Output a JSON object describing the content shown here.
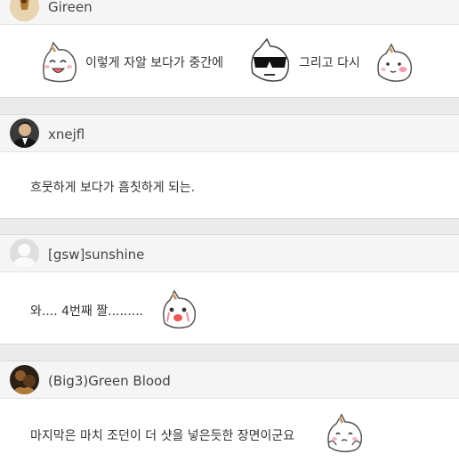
{
  "comments": [
    {
      "username": "Gireen",
      "segments": [
        "이렇게 자알 보다가 중간에",
        "그리고 다시"
      ],
      "emoticons": [
        "laughing-cat-icon",
        "sunglasses-cat-icon",
        "blushing-cat-icon"
      ]
    },
    {
      "username": "xnejfl",
      "text": "흐뭇하게 보다가 흠칫하게 되는."
    },
    {
      "username": "[gsw]sunshine",
      "text": "와.... 4번째 짤.........",
      "emoticons": [
        "crying-cat-icon"
      ]
    },
    {
      "username": "(Big3)Green Blood",
      "text": "마지막은 마치 조던이 더 샷을 넣은듯한 장면이군요",
      "emoticons": [
        "shy-cat-icon"
      ]
    }
  ]
}
